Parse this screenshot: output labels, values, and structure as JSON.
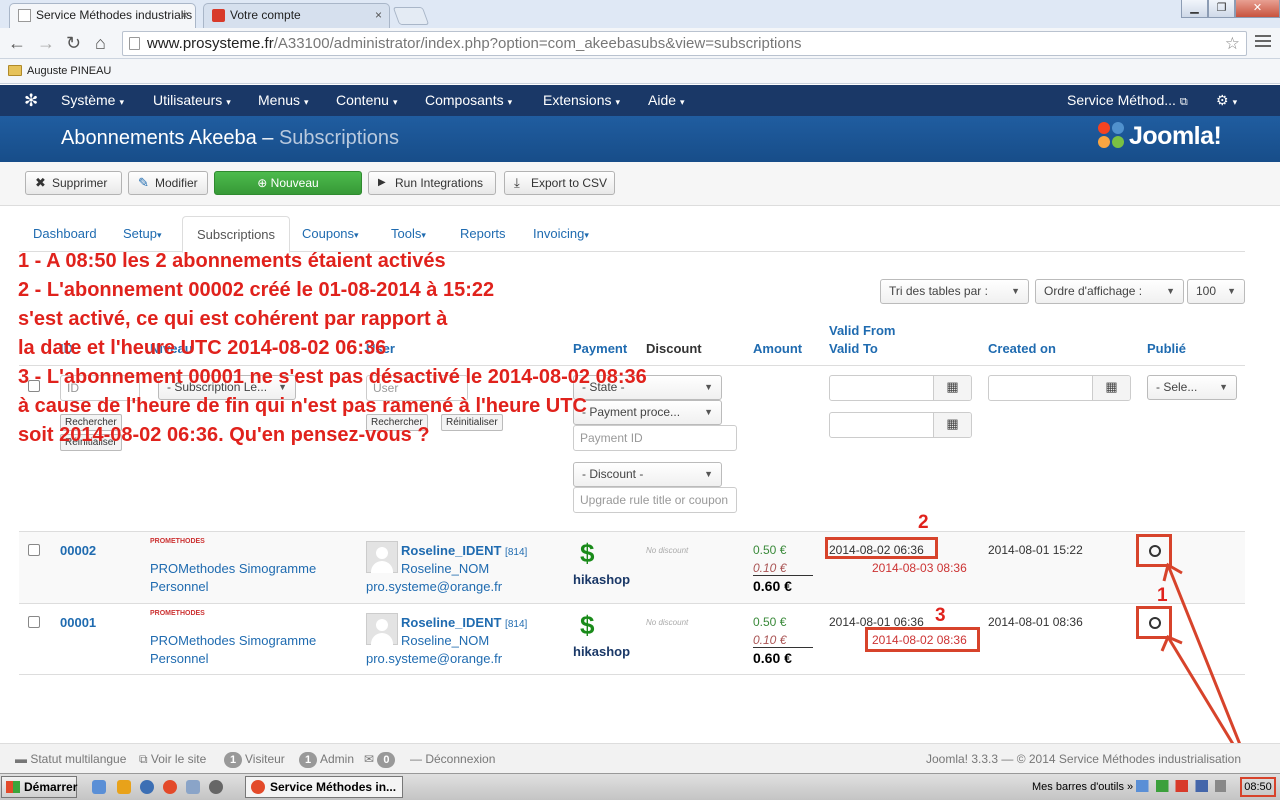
{
  "browser": {
    "tabs": [
      {
        "label": "Service Méthodes industrialis",
        "close": "×"
      },
      {
        "label": "Votre compte",
        "close": "×"
      }
    ],
    "window_buttons": [
      "▁",
      "❐",
      "✕"
    ],
    "url_host": "www.prosysteme.fr",
    "url_path": "/A33100/administrator/index.php?option=com_akeebasubs&view=subscriptions",
    "bookmark": "Auguste PINEAU"
  },
  "joomla_nav": {
    "menus": [
      "Système",
      "Utilisateurs",
      "Menus",
      "Contenu",
      "Composants",
      "Extensions",
      "Aide"
    ],
    "site_link": "Service Méthod...",
    "caret": "▾"
  },
  "header": {
    "title": "Abonnements Akeeba – ",
    "subtitle": "Subscriptions",
    "logo_text": "Joomla!"
  },
  "toolbar": {
    "delete": "Supprimer",
    "edit": "Modifier",
    "new": "Nouveau",
    "run_integrations": "Run Integrations",
    "export_csv": "Export to CSV"
  },
  "component_tabs": [
    "Dashboard",
    "Setup",
    "Subscriptions",
    "Coupons",
    "Tools",
    "Reports",
    "Invoicing"
  ],
  "sorting": {
    "sort_by": "Tri des tables par :",
    "order": "Ordre d'affichage :",
    "limit": "100"
  },
  "columns": {
    "id": "ID",
    "level": "Niveau",
    "user": "User",
    "payment": "Payment",
    "discount": "Discount",
    "amount": "Amount",
    "valid_from": "Valid From",
    "valid_to": "Valid To",
    "created_on": "Created on",
    "published": "Publié"
  },
  "filters": {
    "id_placeholder": "ID",
    "level_select": "- Subscription Le...",
    "user_placeholder": "User",
    "search": "Rechercher",
    "reset": "Réinitialiser",
    "state": "- State -",
    "payment_processor": "- Payment proce...",
    "payment_id_placeholder": "Payment ID",
    "discount": "- Discount -",
    "upgrade_placeholder": "Upgrade rule title or coupon",
    "published_select": "- Sele..."
  },
  "rows": [
    {
      "id": "00002",
      "level_logo": "PROMETHODES",
      "level": "PROMethodes Simogramme",
      "level2": "Personnel",
      "username": "Roseline_IDENT",
      "user_id": "[814]",
      "name": "Roseline_NOM",
      "email": "pro.systeme@orange.fr",
      "processor": "hikashop",
      "discount": "No discount",
      "net": "0.50 €",
      "tax": "0.10 €",
      "gross": "0.60 €",
      "valid_from": "2014-08-02 06:36",
      "valid_to": "2014-08-03 08:36",
      "created_on": "2014-08-01 15:22"
    },
    {
      "id": "00001",
      "level_logo": "PROMETHODES",
      "level": "PROMethodes Simogramme",
      "level2": "Personnel",
      "username": "Roseline_IDENT",
      "user_id": "[814]",
      "name": "Roseline_NOM",
      "email": "pro.systeme@orange.fr",
      "processor": "hikashop",
      "discount": "No discount",
      "net": "0.50 €",
      "tax": "0.10 €",
      "gross": "0.60 €",
      "valid_from": "2014-08-01 06:36",
      "valid_to": "2014-08-02 08:36",
      "created_on": "2014-08-01 08:36"
    }
  ],
  "annotations": {
    "lines": [
      "1 - A 08:50 les 2 abonnements étaient activés",
      "2 - L'abonnement 00002 créé le 01-08-2014 à 15:22",
      "s'est activé, ce qui est cohérent par rapport à",
      "la date et l'heure UTC 2014-08-02 06:36",
      "3 - L'abonnement 00001 ne s'est pas désactivé le 2014-08-02 08:36",
      "à cause de l'heure de fin qui n'est pas ramené à l'heure UTC",
      "soit 2014-08-02 06:36. Qu'en pensez-vous ?"
    ],
    "marker_1": "1",
    "marker_2": "2",
    "marker_3": "3",
    "color": "#e0221c"
  },
  "footer": {
    "multilang": "Statut multilangue",
    "view_site": "Voir le site",
    "visitors_count": "1",
    "visitors": "Visiteur",
    "admin_count": "1",
    "admin": "Admin",
    "messages_count": "0",
    "logout": "Déconnexion",
    "version": "Joomla! 3.3.3  —  © 2014 Service Méthodes industrialisation"
  },
  "taskbar": {
    "start": "Démarrer",
    "app": "Service Méthodes in...",
    "toolbars": "Mes barres d'outils",
    "chevron": "»",
    "clock": "08:50"
  }
}
